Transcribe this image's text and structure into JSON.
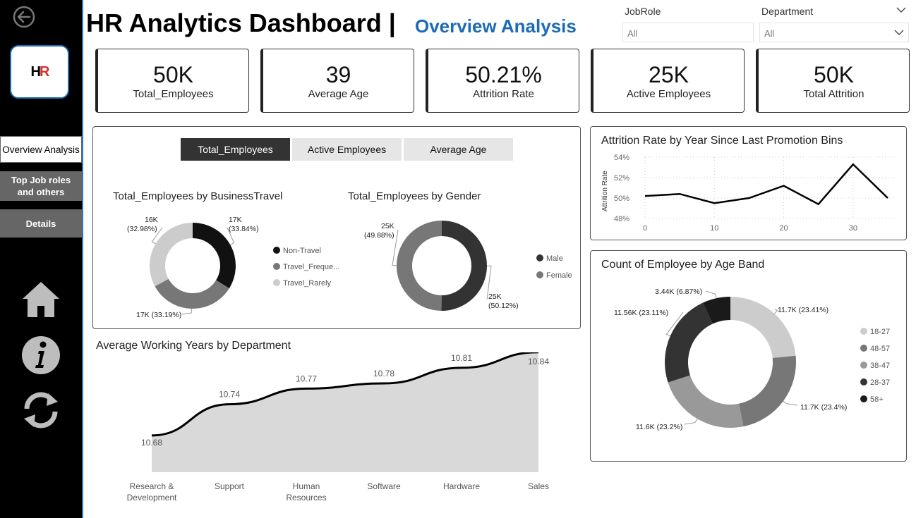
{
  "header": {
    "title": "HR Analytics Dashboard |",
    "subtitle": "Overview Analysis"
  },
  "sidebar": {
    "logo_text_h": "H",
    "logo_text_r": "R",
    "nav": [
      {
        "label": "Overview Analysis",
        "active": true
      },
      {
        "label": "Top Job roles and others",
        "active": false
      },
      {
        "label": "Details",
        "active": false
      }
    ],
    "icons": [
      "back-arrow-icon",
      "home-icon",
      "info-icon",
      "refresh-icon"
    ]
  },
  "filters": {
    "jobrole": {
      "label": "JobRole",
      "value": "All"
    },
    "department": {
      "label": "Department",
      "value": "All"
    }
  },
  "kpis": [
    {
      "value": "50K",
      "label": "Total_Employees"
    },
    {
      "value": "39",
      "label": "Average Age"
    },
    {
      "value": "50.21%",
      "label": "Attrition Rate"
    },
    {
      "value": "25K",
      "label": "Active Employees"
    },
    {
      "value": "50K",
      "label": "Total Attrition"
    }
  ],
  "tabs": [
    {
      "label": "Total_Employees",
      "active": true
    },
    {
      "label": "Active Employees",
      "active": false
    },
    {
      "label": "Average Age",
      "active": false
    }
  ],
  "colors": {
    "brand_blue": "#1d6ab7",
    "dark": "#333333",
    "mid": "#777777",
    "light": "#cccccc"
  },
  "chart_data": [
    {
      "id": "business_travel",
      "type": "pie",
      "title": "Total_Employees by BusinessTravel",
      "slices": [
        {
          "name": "Non-Travel",
          "legend": "Non-Travel",
          "value": 33.84,
          "label": "17K",
          "pct": "(33.84%)",
          "color": "#111111"
        },
        {
          "name": "Travel_Frequently",
          "legend": "Travel_Freque...",
          "value": 33.19,
          "label": "17K (33.19%)",
          "pct": "",
          "color": "#777777"
        },
        {
          "name": "Travel_Rarely",
          "legend": "Travel_Rarely",
          "value": 32.98,
          "label": "16K",
          "pct": "(32.98%)",
          "color": "#cccccc"
        }
      ]
    },
    {
      "id": "gender",
      "type": "pie",
      "title": "Total_Employees by Gender",
      "slices": [
        {
          "name": "Male",
          "value": 50.12,
          "label": "25K",
          "pct": "(50.12%)",
          "color": "#333333"
        },
        {
          "name": "Female",
          "value": 49.88,
          "label": "25K",
          "pct": "(49.88%)",
          "color": "#777777"
        }
      ]
    },
    {
      "id": "attrition_promotion",
      "type": "line",
      "title": "Attrition Rate by Year Since Last Promotion Bins",
      "ylabel": "Attrition Rate",
      "x": [
        0,
        5,
        10,
        15,
        20,
        25,
        30,
        35
      ],
      "y": [
        50.2,
        50.4,
        49.5,
        50.0,
        51.2,
        49.4,
        53.3,
        50.0
      ],
      "xticks": [
        0,
        10,
        20,
        30
      ],
      "yticks": [
        "48%",
        "50%",
        "52%",
        "54%"
      ],
      "ylim": [
        48,
        54
      ]
    },
    {
      "id": "age_band",
      "type": "pie",
      "title": "Count of Employee by Age Band",
      "slices": [
        {
          "name": "18-27",
          "value": 23.41,
          "label": "11.7K (23.41%)",
          "color": "#cccccc"
        },
        {
          "name": "48-57",
          "value": 23.4,
          "label": "11.7K (23.4%)",
          "color": "#777777"
        },
        {
          "name": "38-47",
          "value": 23.2,
          "label": "11.6K (23.2%)",
          "color": "#999999"
        },
        {
          "name": "28-37",
          "value": 23.11,
          "label": "11.56K (23.11%)",
          "color": "#333333"
        },
        {
          "name": "58+",
          "value": 6.87,
          "label": "3.44K (6.87%)",
          "color": "#1a1a1a"
        }
      ]
    },
    {
      "id": "working_years",
      "type": "area",
      "title": "Average Working Years by Department",
      "categories": [
        "Research & Development",
        "Support",
        "Human Resources",
        "Software",
        "Hardware",
        "Sales"
      ],
      "values": [
        10.68,
        10.74,
        10.77,
        10.78,
        10.81,
        10.84
      ],
      "value_labels": [
        "10.68",
        "10.74",
        "10.77",
        "10.78",
        "10.81",
        "10.84"
      ]
    }
  ]
}
